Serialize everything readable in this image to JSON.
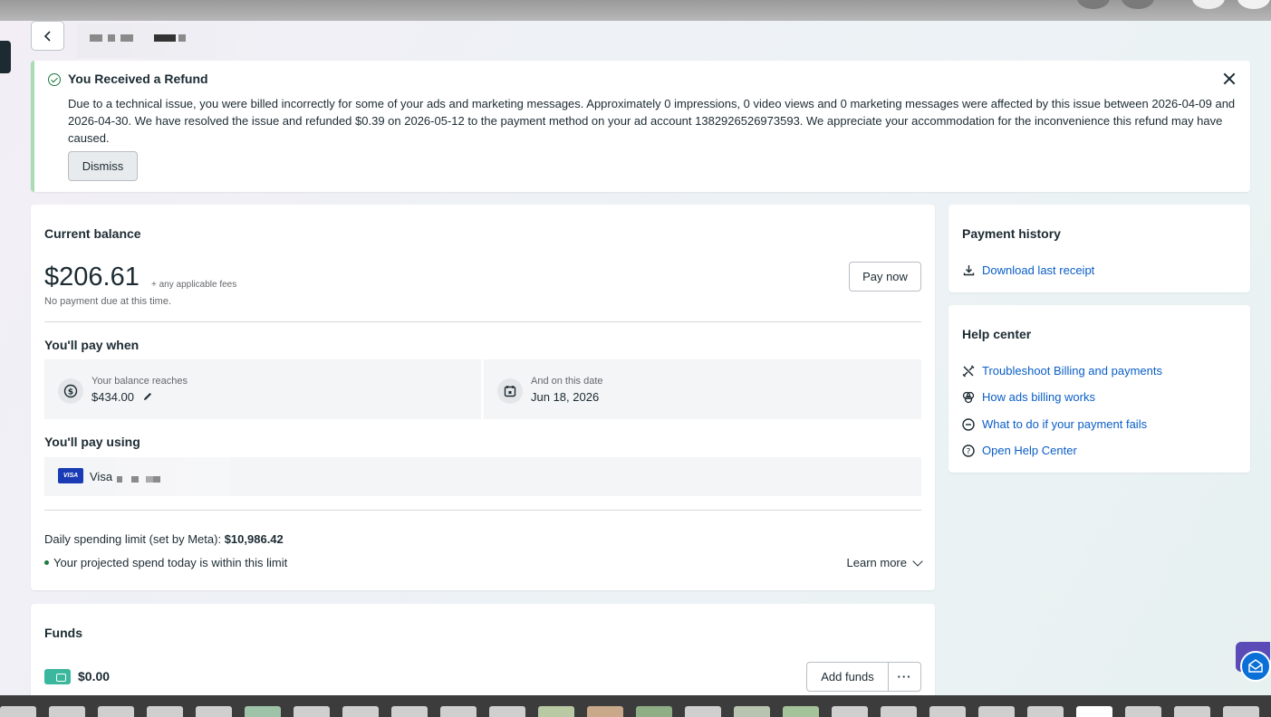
{
  "banner": {
    "title": "You Received a Refund",
    "message": "Due to a technical issue, you were billed incorrectly for some of your ads and marketing messages. Approximately 0 impressions, 0 video views and 0 marketing messages were affected by this issue between 2026-04-09 and 2026-04-30. We have resolved the issue and refunded $0.39 on 2026-05-12 to the payment method on your ad account 1382926526973593. We appreciate your accommodation for the inconvenience this refund may have caused.",
    "dismiss_label": "Dismiss"
  },
  "balance": {
    "heading": "Current balance",
    "amount": "$206.61",
    "fees_note": "+ any applicable fees",
    "due_note": "No payment due at this time.",
    "pay_now_label": "Pay now",
    "pay_when_heading": "You'll pay when",
    "threshold_label": "Your balance reaches",
    "threshold_value": "$434.00",
    "date_label": "And on this date",
    "date_value": "Jun 18, 2026",
    "pay_using_heading": "You'll pay using",
    "card_brand": "Visa",
    "limit_label": "Daily spending limit (set by Meta):",
    "limit_value": "$10,986.42",
    "projected_note": "Your projected spend today is within this limit",
    "learn_more_label": "Learn more"
  },
  "payment_history": {
    "heading": "Payment history",
    "download_label": "Download last receipt"
  },
  "help_center": {
    "heading": "Help center",
    "links": [
      {
        "label": "Troubleshoot Billing and payments",
        "icon": "tools-icon"
      },
      {
        "label": "How ads billing works",
        "icon": "billing-icon"
      },
      {
        "label": "What to do if your payment fails",
        "icon": "minus-circle-icon"
      },
      {
        "label": "Open Help Center",
        "icon": "question-icon"
      }
    ]
  },
  "funds": {
    "heading": "Funds",
    "amount": "$0.00",
    "add_funds_label": "Add funds",
    "more_label": "···"
  },
  "colors": {
    "link": "#0a5ec7",
    "success": "#1c7a3d",
    "banner_accent": "#a8dcb3",
    "visa": "#1a3bb3",
    "wallet": "#3ab79c"
  }
}
